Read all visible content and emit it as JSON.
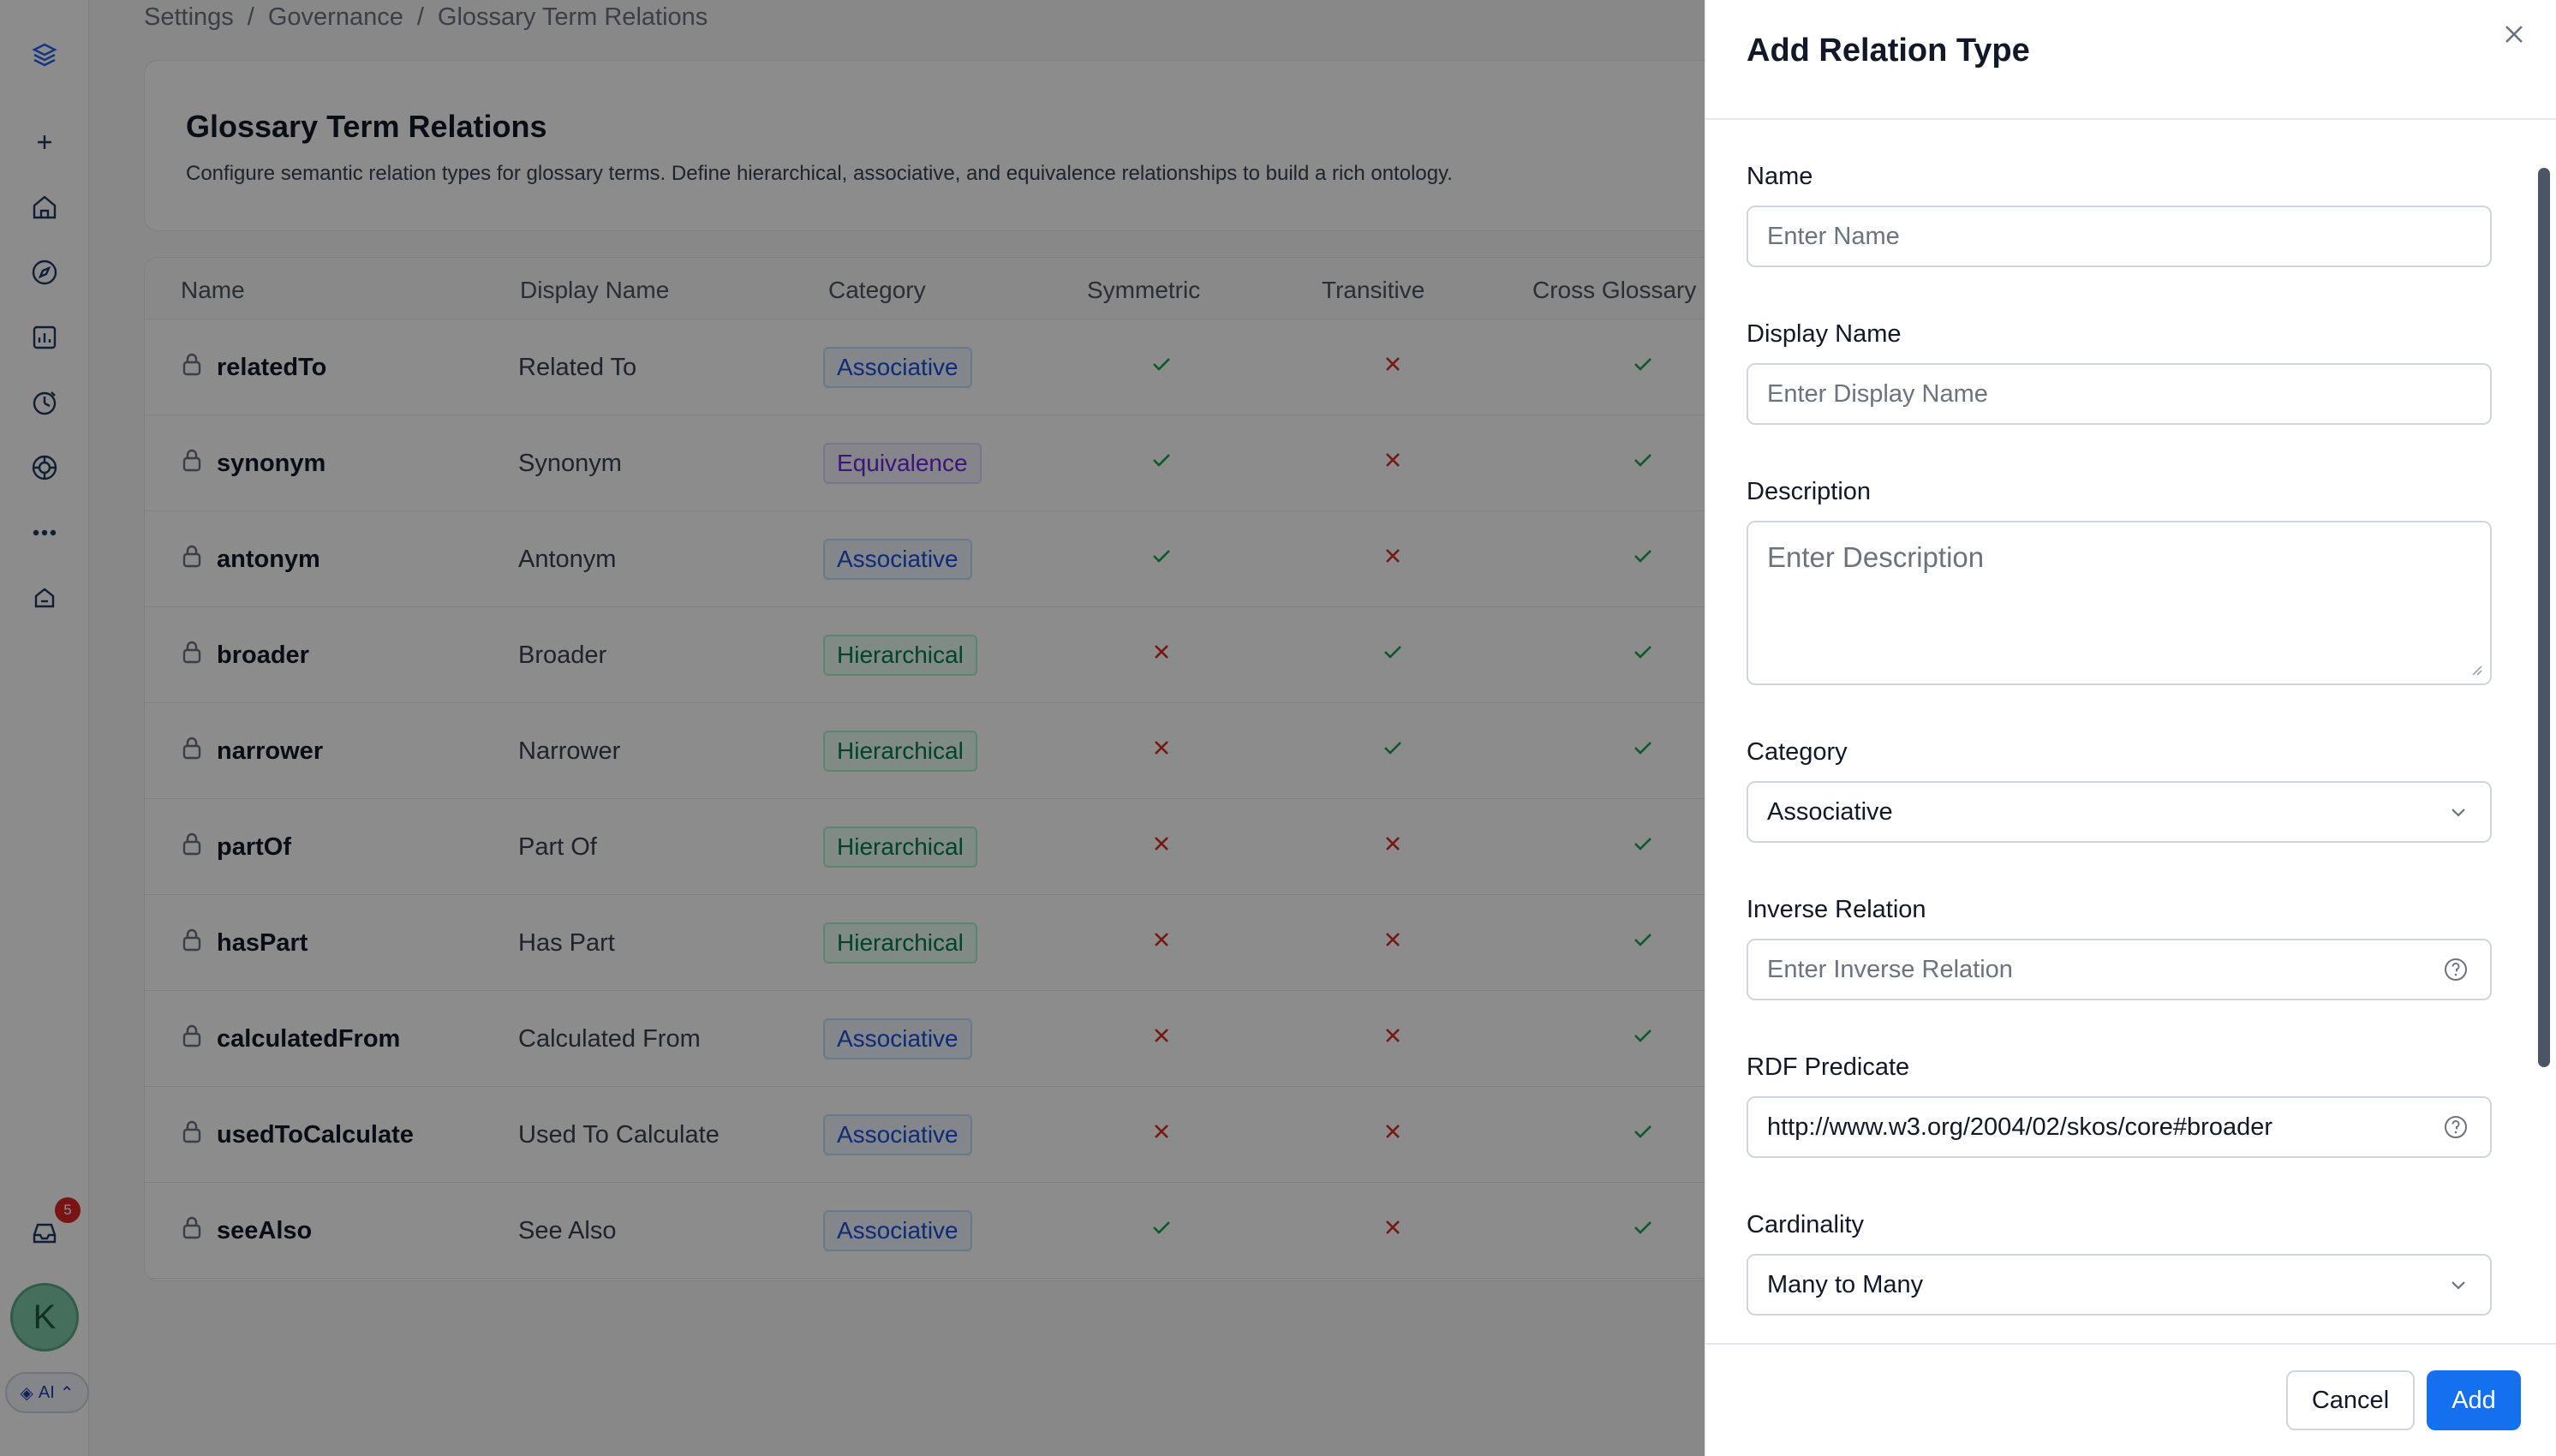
{
  "breadcrumb": {
    "items": [
      "Settings",
      "Governance",
      "Glossary Term Relations"
    ],
    "separator": "/"
  },
  "page": {
    "title": "Glossary Term Relations",
    "description": "Configure semantic relation types for glossary terms. Define hierarchical, associative, and equivalence relationships to build a rich ontology."
  },
  "table": {
    "columns": [
      "Name",
      "Display Name",
      "Category",
      "Symmetric",
      "Transitive",
      "Cross Glossary"
    ],
    "rows": [
      {
        "name": "relatedTo",
        "display": "Related To",
        "category": "Associative",
        "symmetric": true,
        "transitive": false,
        "cross": true
      },
      {
        "name": "synonym",
        "display": "Synonym",
        "category": "Equivalence",
        "symmetric": true,
        "transitive": false,
        "cross": true
      },
      {
        "name": "antonym",
        "display": "Antonym",
        "category": "Associative",
        "symmetric": true,
        "transitive": false,
        "cross": true
      },
      {
        "name": "broader",
        "display": "Broader",
        "category": "Hierarchical",
        "symmetric": false,
        "transitive": true,
        "cross": true
      },
      {
        "name": "narrower",
        "display": "Narrower",
        "category": "Hierarchical",
        "symmetric": false,
        "transitive": true,
        "cross": true
      },
      {
        "name": "partOf",
        "display": "Part Of",
        "category": "Hierarchical",
        "symmetric": false,
        "transitive": false,
        "cross": true
      },
      {
        "name": "hasPart",
        "display": "Has Part",
        "category": "Hierarchical",
        "symmetric": false,
        "transitive": false,
        "cross": true
      },
      {
        "name": "calculatedFrom",
        "display": "Calculated From",
        "category": "Associative",
        "symmetric": false,
        "transitive": false,
        "cross": true
      },
      {
        "name": "usedToCalculate",
        "display": "Used To Calculate",
        "category": "Associative",
        "symmetric": false,
        "transitive": false,
        "cross": true
      },
      {
        "name": "seeAlso",
        "display": "See Also",
        "category": "Associative",
        "symmetric": true,
        "transitive": false,
        "cross": true
      }
    ]
  },
  "sidebar": {
    "icons": [
      "logo-icon",
      "plus-icon",
      "home-icon",
      "explore-icon",
      "insights-icon",
      "observability-icon",
      "governance-icon",
      "more-icon",
      "knowledge-icon"
    ],
    "notification_count": "5",
    "avatar_letter": "K",
    "ai_label": "AI"
  },
  "drawer": {
    "title": "Add Relation Type",
    "fields": {
      "name": {
        "label": "Name",
        "placeholder": "Enter Name"
      },
      "display_name": {
        "label": "Display Name",
        "placeholder": "Enter Display Name"
      },
      "description": {
        "label": "Description",
        "placeholder": "Enter Description"
      },
      "category": {
        "label": "Category",
        "value": "Associative"
      },
      "inverse_relation": {
        "label": "Inverse Relation",
        "placeholder": "Enter Inverse Relation"
      },
      "rdf_predicate": {
        "label": "RDF Predicate",
        "value": "http://www.w3.org/2004/02/skos/core#broader"
      },
      "cardinality": {
        "label": "Cardinality",
        "value": "Many to Many"
      }
    },
    "cancel_label": "Cancel",
    "add_label": "Add"
  },
  "colors": {
    "check": "#16a34a",
    "cross": "#dc2626",
    "primary": "#1570ef"
  }
}
